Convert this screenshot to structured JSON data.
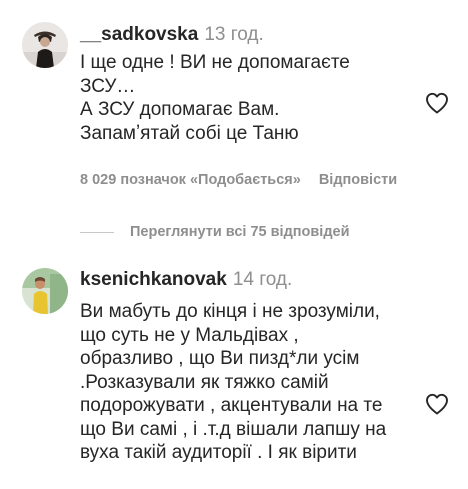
{
  "comments": [
    {
      "username": "__sadkovska",
      "time": "13 год.",
      "lines": [
        "І ще одне ! ВИ не допомагаєте",
        "ЗСУ…",
        "А ЗСУ допомагає Вам.",
        "Запамʼятай собі це Таню"
      ],
      "likes_label": "8 029 позначок «Подобається»",
      "reply_label": "Відповісти"
    },
    {
      "username": "ksenichkanovak",
      "time": "14 год.",
      "lines": [
        "Ви мабуть до кінця і не зрозуміли,",
        "що суть не у Мальдівах ,",
        "образливо , що Ви пизд*ли усім",
        ".Розказували як тяжко самій",
        "подорожувати , акцентували на те",
        "що Ви самі , і .т.д вішали лапшу на",
        "вуха такій аудиторії . І як вірити"
      ]
    }
  ],
  "view_replies_label": "Переглянути всі 75 відповідей",
  "icons": {
    "like": "heart-outline-icon"
  },
  "colors": {
    "text": "#262626",
    "secondary": "#8e8e8e",
    "divider": "#c7c7c7"
  }
}
